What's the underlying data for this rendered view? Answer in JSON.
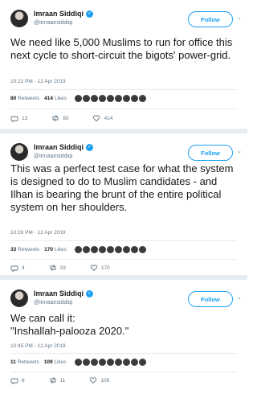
{
  "tweets": [
    {
      "name": "Imraan Siddiqi",
      "handle": "@imraansiddiqi",
      "follow_label": "Follow",
      "text": "We need like 5,000 Muslims to run for office this next cycle to short-circuit the bigots' power-grid.",
      "timestamp": "10:22 PM - 12 Apr 2019",
      "retweets_count": "80",
      "retweets_label": "Retweets",
      "likes_count": "414",
      "likes_label": "Likes",
      "replies": "13",
      "retweets": "80",
      "likes": "414"
    },
    {
      "name": "Imraan Siddiqi",
      "handle": "@imraansiddiqi",
      "follow_label": "Follow",
      "text": "This was a perfect test case for what the system is designed to do to Muslim candidates - and Ilhan is bearing the brunt of the entire political system on her shoulders.",
      "timestamp": "10:26 PM - 12 Apr 2019",
      "retweets_count": "33",
      "retweets_label": "Retweets",
      "likes_count": "170",
      "likes_label": "Likes",
      "replies": "4",
      "retweets": "33",
      "likes": "170"
    },
    {
      "name": "Imraan Siddiqi",
      "handle": "@imraansiddiqi",
      "follow_label": "Follow",
      "text": "We can call it:\n\"Inshallah-palooza 2020.\"",
      "timestamp": "10:45 PM - 12 Apr 2019",
      "retweets_count": "11",
      "retweets_label": "Retweets",
      "likes_count": "109",
      "likes_label": "Likes",
      "replies": "6",
      "retweets": "11",
      "likes": "109"
    }
  ],
  "icons": {
    "reply": "reply-icon",
    "retweet": "retweet-icon",
    "like": "heart-icon",
    "verified": "verified-badge-icon",
    "chevron": "chevron-down-icon"
  },
  "colors": {
    "accent": "#1da1f2",
    "muted": "#657786",
    "divider": "#e6ecf0"
  }
}
